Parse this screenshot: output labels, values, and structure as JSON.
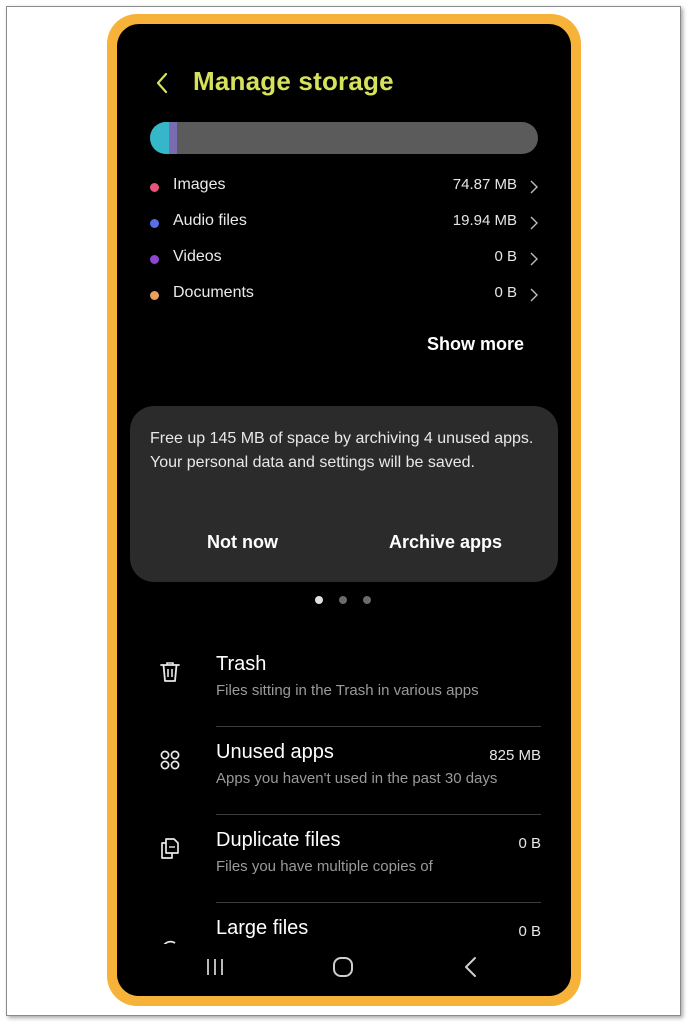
{
  "header": {
    "title": "Manage storage"
  },
  "colors": {
    "title": "#d6e35a",
    "images": "#e8557a",
    "audio": "#5a6ee8",
    "videos": "#8e45d6",
    "documents": "#e8a05a",
    "frame": "#f7b23a"
  },
  "usage_bar": {
    "segments": [
      {
        "name": "Images",
        "fraction": 0.05,
        "color": "#35b6c9"
      },
      {
        "name": "Audio files",
        "fraction": 0.012,
        "color": "#7a6ab0"
      }
    ]
  },
  "categories": [
    {
      "label": "Images",
      "size": "74.87 MB"
    },
    {
      "label": "Audio files",
      "size": "19.94 MB"
    },
    {
      "label": "Videos",
      "size": "0 B"
    },
    {
      "label": "Documents",
      "size": "0 B"
    }
  ],
  "show_more": "Show more",
  "card": {
    "text": "Free up 145 MB of space by archiving 4 unused apps. Your personal data and settings will be saved.",
    "not_now": "Not now",
    "archive": "Archive apps"
  },
  "list": [
    {
      "title": "Trash",
      "subtitle": "Files sitting in the Trash in various apps",
      "value": "",
      "icon": "trash-icon"
    },
    {
      "title": "Unused apps",
      "subtitle": "Apps you haven't used in the past 30 days",
      "value": "825 MB",
      "icon": "apps-grid-icon"
    },
    {
      "title": "Duplicate files",
      "subtitle": "Files you have multiple copies of",
      "value": "0 B",
      "icon": "duplicate-files-icon"
    },
    {
      "title": "Large files",
      "subtitle": "",
      "value": "0 B",
      "icon": "large-files-icon"
    }
  ]
}
